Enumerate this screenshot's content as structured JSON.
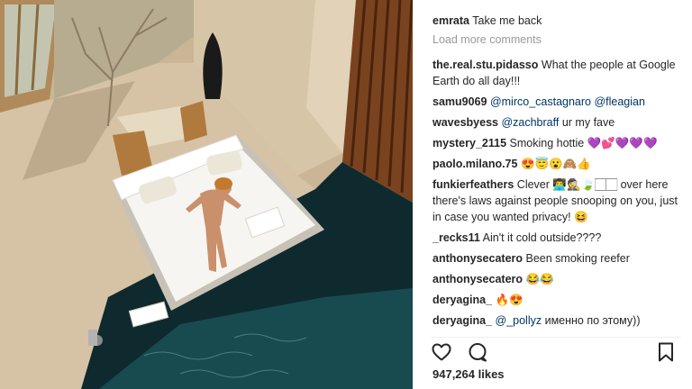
{
  "post": {
    "caption_user": "emrata",
    "caption_text": "Take me back",
    "load_more_label": "Load more comments",
    "likes_count": "947,264",
    "likes_label": "likes"
  },
  "comments": [
    {
      "user": "the.real.stu.pidasso",
      "text": "What the people at Google Earth do all day!!!"
    },
    {
      "user": "samu9069",
      "mentions": "@mirco_castagnaro @fleagian"
    },
    {
      "user": "wavesbyess",
      "mentions": "@zachbraff",
      "text": "ur my fave"
    },
    {
      "user": "mystery_2115",
      "text": "Smoking hottie",
      "emoji": "💜💕💜💜💜"
    },
    {
      "user": "paolo.milano.75",
      "emoji": "😍😇😮🙈👍"
    },
    {
      "user": "funkierfeathers",
      "text": "Clever",
      "emoji": "👨‍💻🕵️🍃🏻🏻",
      "text2": "over here there's laws against people snooping on you, just in case you wanted privacy!",
      "emoji2": "😆"
    },
    {
      "user": "_recks11",
      "text": "Ain't it cold outside????"
    },
    {
      "user": "anthonysecatero",
      "text": "Been smoking reefer"
    },
    {
      "user": "anthonysecatero",
      "emoji": "😂😂"
    },
    {
      "user": "deryagina_",
      "emoji": "🔥😍"
    },
    {
      "user": "deryagina_",
      "mentions": "@_pollyz",
      "text": "именно по этому))"
    }
  ],
  "icons": {
    "like": "heart-icon",
    "comment": "comment-icon",
    "save": "bookmark-icon"
  }
}
